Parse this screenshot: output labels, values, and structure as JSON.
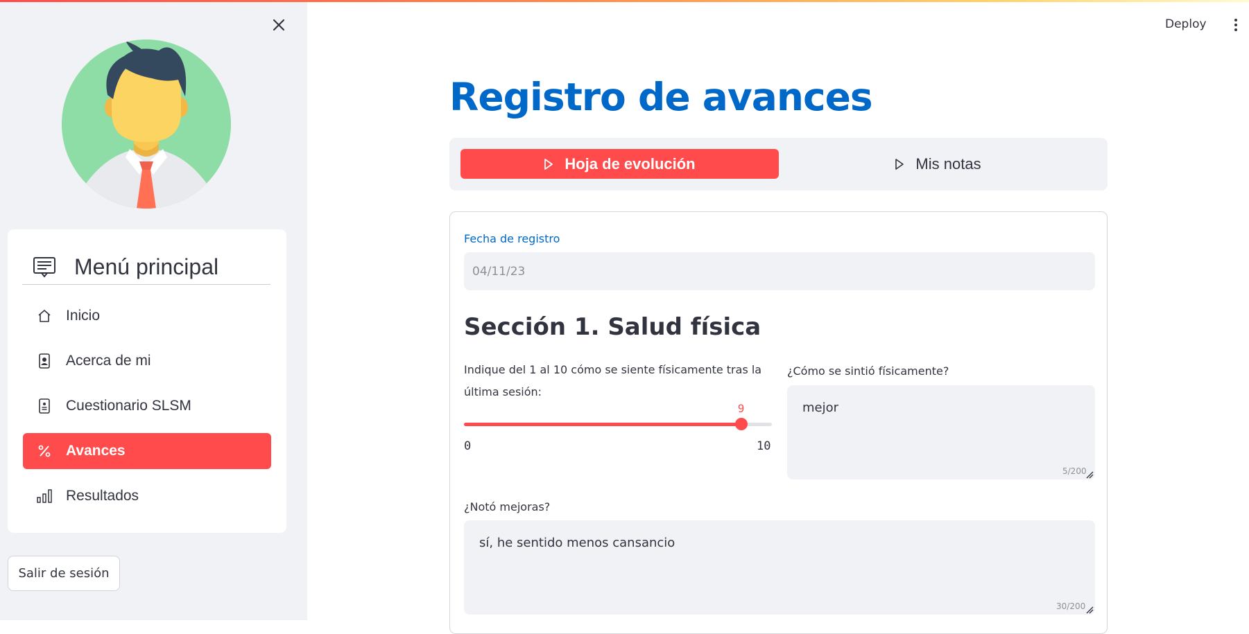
{
  "header": {
    "deploy_label": "Deploy",
    "menu_icon": "kebab-vertical-icon"
  },
  "sidebar": {
    "close_icon": "close-icon",
    "avatar_icon": "user-avatar-icon",
    "menu": {
      "title": "Menú principal",
      "icon": "message-list-icon",
      "items": [
        {
          "label": "Inicio",
          "icon": "house-icon",
          "active": false
        },
        {
          "label": "Acerca de mi",
          "icon": "person-badge-icon",
          "active": false
        },
        {
          "label": "Cuestionario SLSM",
          "icon": "clipboard-person-icon",
          "active": false
        },
        {
          "label": "Avances",
          "icon": "percent-icon",
          "active": true
        },
        {
          "label": "Resultados",
          "icon": "bar-chart-icon",
          "active": false
        }
      ]
    },
    "logout_label": "Salir de sesión"
  },
  "main": {
    "title": "Registro de avances",
    "tabs": [
      {
        "label": "Hoja de evolución",
        "icon": "play-outline-icon",
        "active": true
      },
      {
        "label": "Mis notas",
        "icon": "play-outline-icon",
        "active": false
      }
    ],
    "form": {
      "date_label": "Fecha de registro",
      "date_value": "04/11/23",
      "section_title": "Sección 1. Salud física",
      "slider": {
        "label": "Indique del 1 al 10 cómo se siente físicamente tras la última sesión:",
        "min": 0,
        "max": 10,
        "value": 9,
        "min_label": "0",
        "max_label": "10",
        "value_label": "9"
      },
      "feeling": {
        "label": "¿Cómo se sintió físicamente?",
        "value": "mejor",
        "counter": "5/200"
      },
      "improvements": {
        "label": "¿Notó mejoras?",
        "value": "sí, he sentido menos cansancio",
        "counter": "30/200"
      }
    }
  },
  "colors": {
    "primary": "#ff4b4b",
    "title_blue": "#0068c9",
    "sidebar_bg": "#f0f2f6",
    "input_bg": "#f0f2f6",
    "text": "#31333f",
    "avatar_bg": "#8fdda6"
  }
}
